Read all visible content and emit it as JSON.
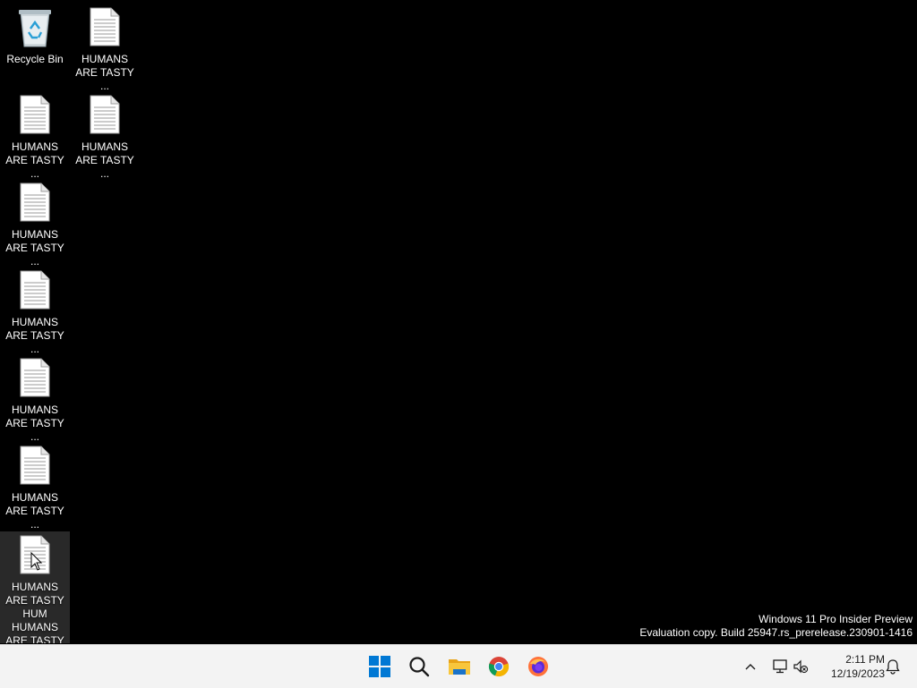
{
  "desktop": {
    "icons": [
      {
        "label": "Recycle Bin",
        "type": "recycle-bin"
      },
      {
        "label": "HUMANS ARE TASTY ...",
        "type": "text-file"
      },
      {
        "label": "HUMANS ARE TASTY ...",
        "type": "text-file"
      },
      {
        "label": "HUMANS ARE TASTY ...",
        "type": "text-file"
      },
      {
        "label": "HUMANS ARE TASTY ...",
        "type": "text-file"
      },
      {
        "label": "HUMANS ARE TASTY ...",
        "type": "text-file"
      },
      {
        "label": "HUMANS ARE TASTY ...",
        "type": "text-file"
      },
      {
        "label": "HUMANS ARE TASTY ...",
        "type": "text-file"
      },
      {
        "label": "HUMANS ARE TASTY HUM HUMANS ARE TASTY",
        "type": "text-file",
        "selected": true
      }
    ]
  },
  "watermark": {
    "line1": "Windows 11 Pro Insider Preview",
    "line2": "Evaluation copy. Build 25947.rs_prerelease.230901-1416"
  },
  "taskbar": {
    "apps": [
      "start-icon",
      "search-icon",
      "file-explorer-icon",
      "chrome-icon",
      "firefox-icon"
    ],
    "tray": [
      "chevron-up-icon",
      "network-icon",
      "volume-muted-icon",
      "notification-bell-icon"
    ],
    "time": "2:11 PM",
    "date": "12/19/2023"
  },
  "colors": {
    "desktop_bg": "#000000",
    "taskbar_bg": "#f3f3f3",
    "start_blue": "#0078d4"
  }
}
